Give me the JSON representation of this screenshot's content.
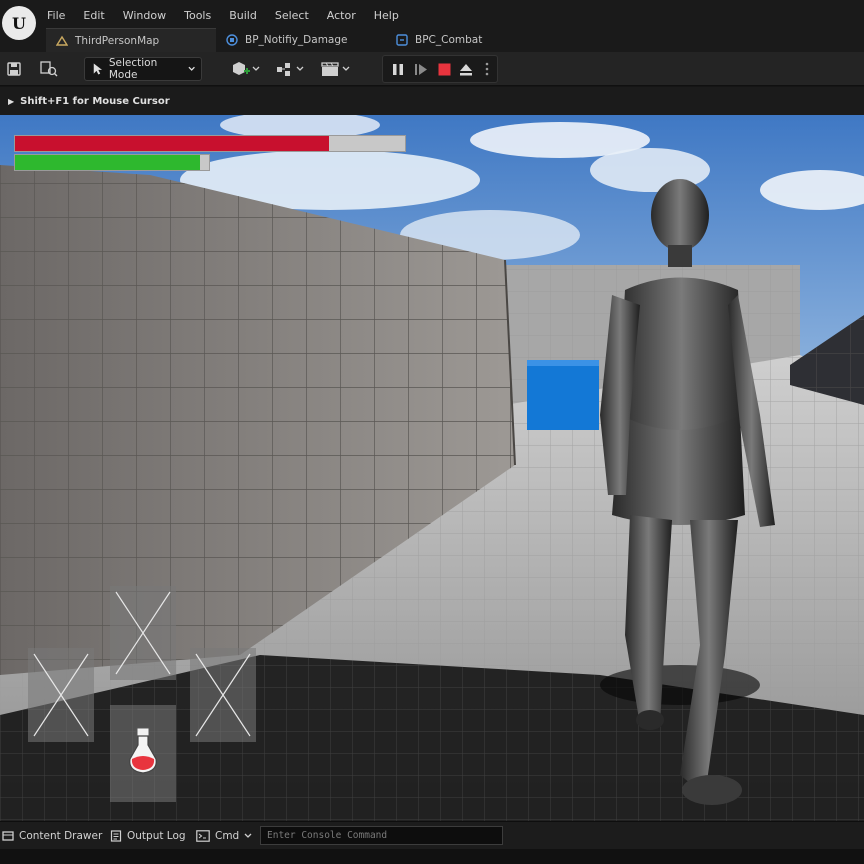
{
  "menu": [
    "File",
    "Edit",
    "Window",
    "Tools",
    "Build",
    "Select",
    "Actor",
    "Help"
  ],
  "tabs": [
    {
      "label": "ThirdPersonMap",
      "icon": "level-icon"
    },
    {
      "label": "BP_Notifiy_Damage",
      "icon": "blueprint-icon"
    },
    {
      "label": "BPC_Combat",
      "icon": "component-icon"
    }
  ],
  "toolbar": {
    "selection_mode": "Selection Mode",
    "icons": [
      "save-icon",
      "browse-icon",
      "add-actor-icon",
      "snap-icon",
      "cinematics-icon",
      "pause-icon",
      "frame-skip-icon",
      "stop-icon",
      "eject-icon",
      "more-icon"
    ]
  },
  "viewport": {
    "hint": "Shift+F1 for Mouse Cursor"
  },
  "hud": {
    "health_fraction": 0.805,
    "stamina_fraction": 0.955,
    "health_color": "#c8102e",
    "stamina_color": "#2eb82e",
    "slots": [
      "empty-slot-icon",
      "empty-slot-icon",
      "empty-slot-icon",
      "potion-icon"
    ]
  },
  "bottombar": {
    "content_drawer": "Content Drawer",
    "output_log": "Output Log",
    "cmd": "Cmd",
    "console_placeholder": "Enter Console Command"
  }
}
